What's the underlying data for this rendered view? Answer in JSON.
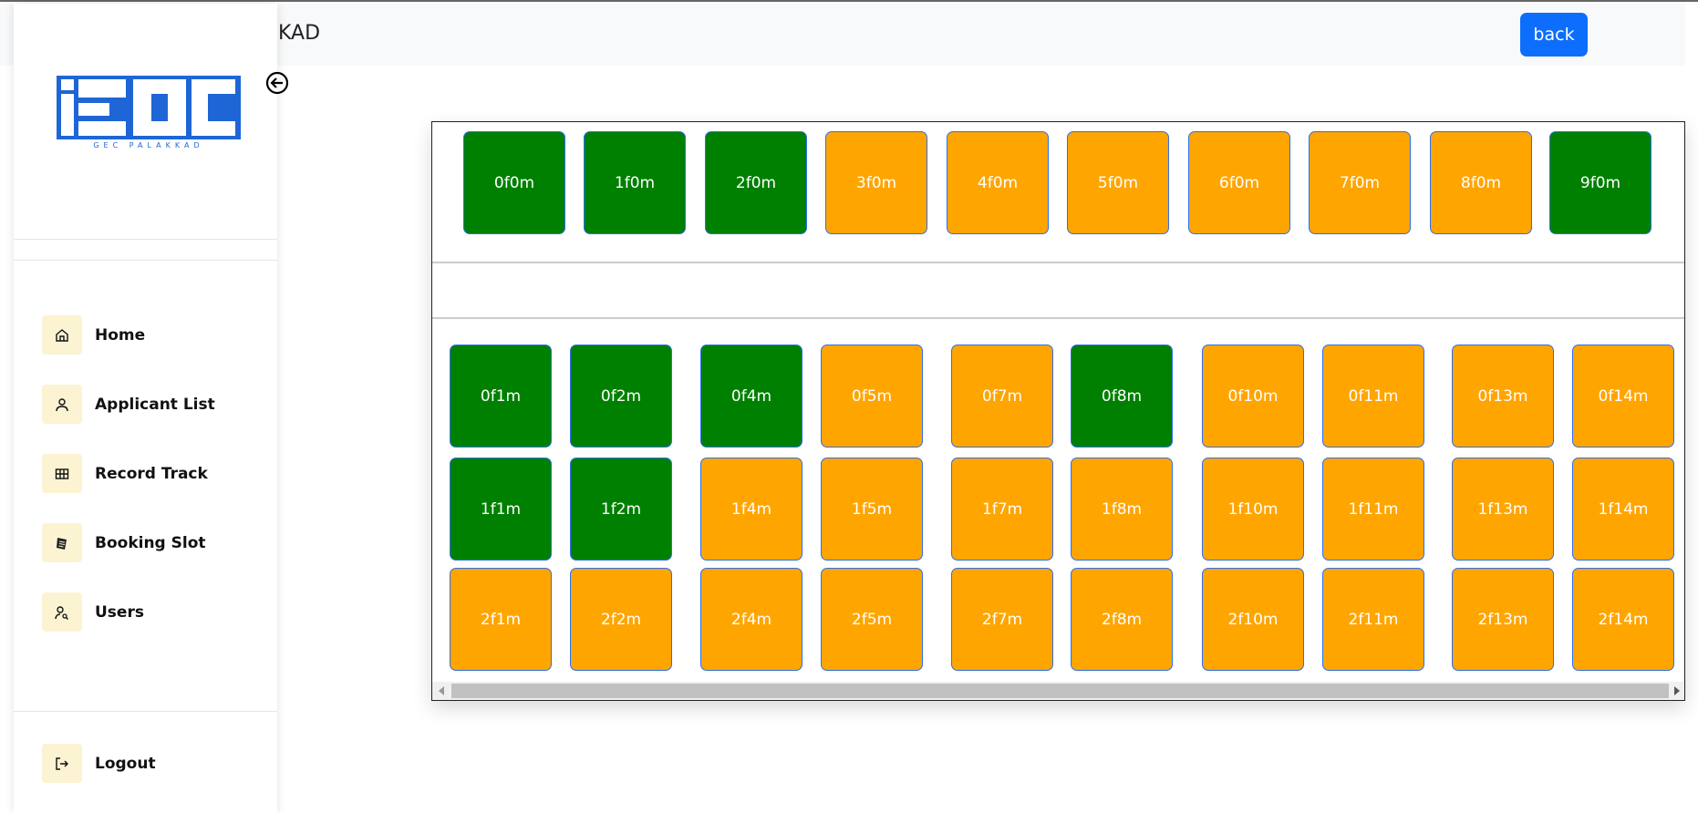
{
  "header": {
    "title": "KAD",
    "back_label": "back"
  },
  "sidebar": {
    "logo_text": "iEDC",
    "logo_subtext": "GEC PALAKKAD",
    "items": [
      {
        "label": "Home",
        "icon": "home-icon"
      },
      {
        "label": "Applicant List",
        "icon": "person-icon"
      },
      {
        "label": "Record Track",
        "icon": "grid-icon"
      },
      {
        "label": "Booking Slot",
        "icon": "notebook-icon"
      },
      {
        "label": "Users",
        "icon": "user-search-icon"
      }
    ],
    "logout_label": "Logout"
  },
  "colors": {
    "available": "#ffa500",
    "booked": "#008000",
    "tile_border": "#2e6ff0",
    "accent": "#0d6efd"
  },
  "slots": {
    "top_row": [
      {
        "label": "0f0m",
        "status": "booked"
      },
      {
        "label": "1f0m",
        "status": "booked"
      },
      {
        "label": "2f0m",
        "status": "booked"
      },
      {
        "label": "3f0m",
        "status": "available"
      },
      {
        "label": "4f0m",
        "status": "available"
      },
      {
        "label": "5f0m",
        "status": "available"
      },
      {
        "label": "6f0m",
        "status": "available"
      },
      {
        "label": "7f0m",
        "status": "available"
      },
      {
        "label": "8f0m",
        "status": "available"
      },
      {
        "label": "9f0m",
        "status": "booked"
      }
    ],
    "grid": [
      [
        {
          "label": "0f1m",
          "status": "booked"
        },
        {
          "label": "0f2m",
          "status": "booked"
        },
        {
          "label": "0f4m",
          "status": "booked"
        },
        {
          "label": "0f5m",
          "status": "available"
        },
        {
          "label": "0f7m",
          "status": "available"
        },
        {
          "label": "0f8m",
          "status": "booked"
        },
        {
          "label": "0f10m",
          "status": "available"
        },
        {
          "label": "0f11m",
          "status": "available"
        },
        {
          "label": "0f13m",
          "status": "available"
        },
        {
          "label": "0f14m",
          "status": "available"
        }
      ],
      [
        {
          "label": "1f1m",
          "status": "booked"
        },
        {
          "label": "1f2m",
          "status": "booked"
        },
        {
          "label": "1f4m",
          "status": "available"
        },
        {
          "label": "1f5m",
          "status": "available"
        },
        {
          "label": "1f7m",
          "status": "available"
        },
        {
          "label": "1f8m",
          "status": "available"
        },
        {
          "label": "1f10m",
          "status": "available"
        },
        {
          "label": "1f11m",
          "status": "available"
        },
        {
          "label": "1f13m",
          "status": "available"
        },
        {
          "label": "1f14m",
          "status": "available"
        }
      ],
      [
        {
          "label": "2f1m",
          "status": "available"
        },
        {
          "label": "2f2m",
          "status": "available"
        },
        {
          "label": "2f4m",
          "status": "available"
        },
        {
          "label": "2f5m",
          "status": "available"
        },
        {
          "label": "2f7m",
          "status": "available"
        },
        {
          "label": "2f8m",
          "status": "available"
        },
        {
          "label": "2f10m",
          "status": "available"
        },
        {
          "label": "2f11m",
          "status": "available"
        },
        {
          "label": "2f13m",
          "status": "available"
        },
        {
          "label": "2f14m",
          "status": "available"
        }
      ]
    ]
  }
}
